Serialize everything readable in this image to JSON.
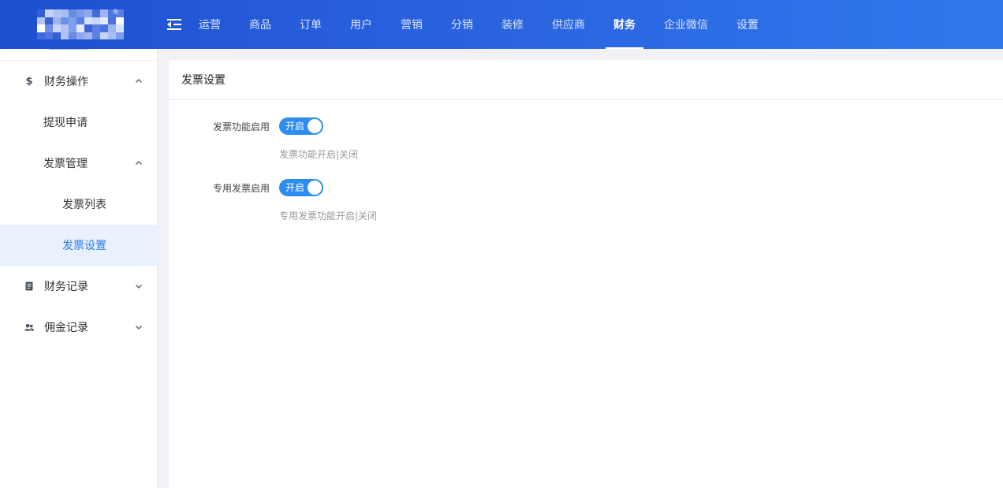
{
  "header": {
    "logo_mark": "®",
    "nav": [
      "运营",
      "商品",
      "订单",
      "用户",
      "营销",
      "分销",
      "装修",
      "供应商",
      "财务",
      "企业微信",
      "设置"
    ],
    "active_index": 8
  },
  "sidebar": {
    "groups": [
      {
        "icon": "dollar-icon",
        "label": "财务操作",
        "expanded": true
      },
      {
        "icon": "document-icon",
        "label": "财务记录",
        "expanded": false
      },
      {
        "icon": "users-icon",
        "label": "佣金记录",
        "expanded": false
      }
    ],
    "items": {
      "withdraw": "提现申请",
      "invoice_manage": "发票管理",
      "invoice_list": "发票列表",
      "invoice_settings": "发票设置"
    }
  },
  "main": {
    "title": "发票设置",
    "fields": [
      {
        "label": "发票功能启用",
        "switch_text": "开启",
        "enabled": true,
        "help": "发票功能开启|关闭"
      },
      {
        "label": "专用发票启用",
        "switch_text": "开启",
        "enabled": true,
        "help": "专用发票功能开启|关闭"
      }
    ]
  },
  "colors": {
    "header_start": "#1e4fd0",
    "header_end": "#2f78ec",
    "accent": "#2d8cf0",
    "active_text": "#2d7be5",
    "active_bg": "#e9f1fd"
  }
}
